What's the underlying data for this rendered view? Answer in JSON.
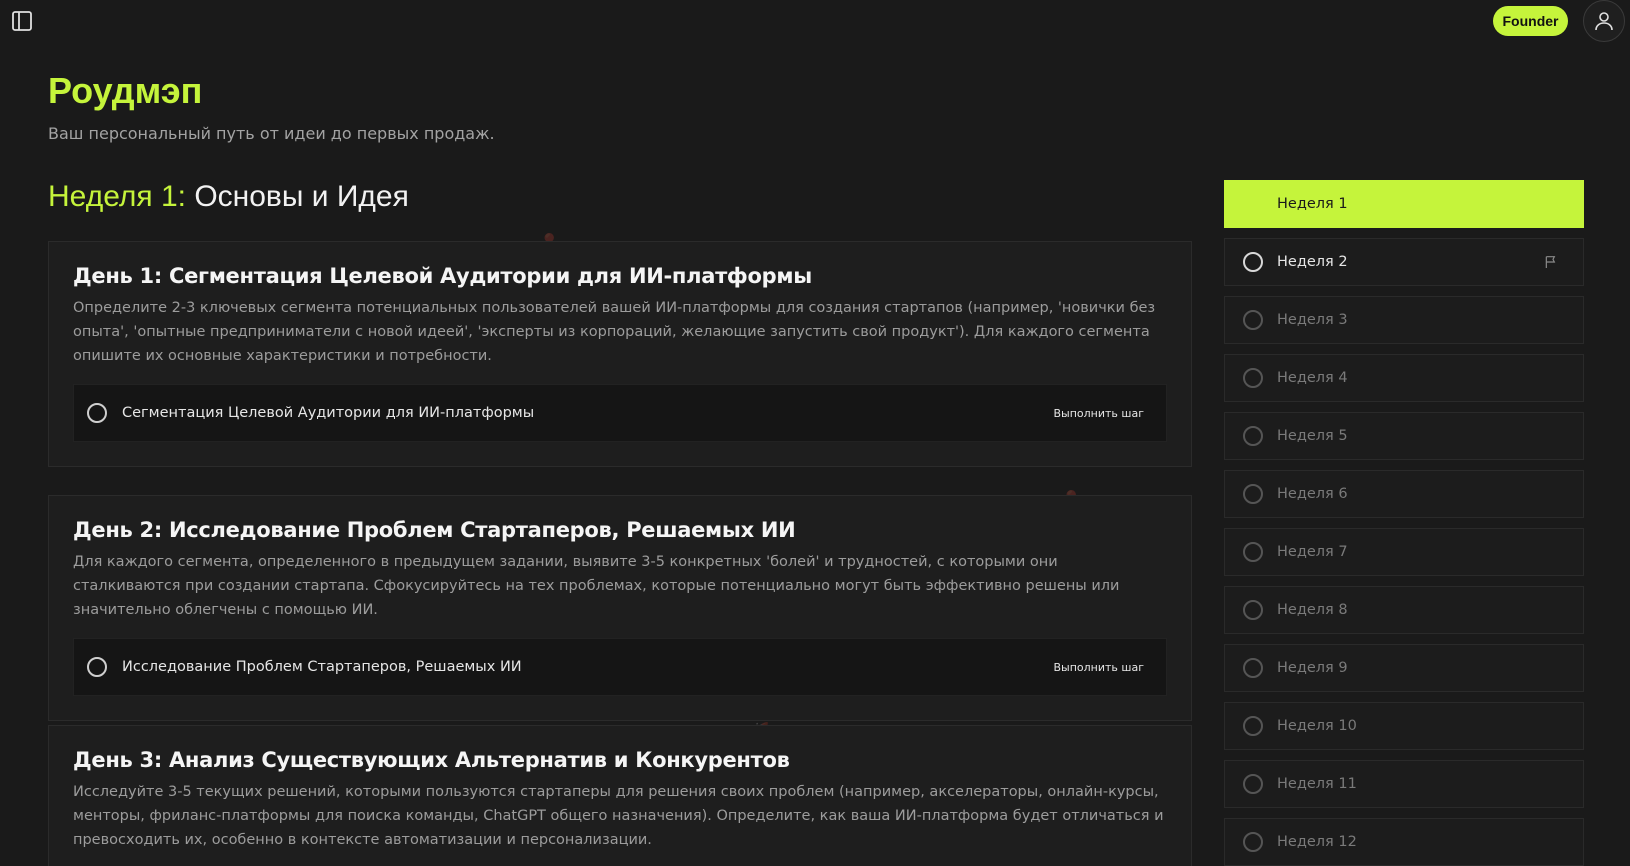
{
  "header": {
    "role_badge": "Founder",
    "title": "Роудмэп",
    "subtitle": "Ваш персональный путь от идеи до первых продаж."
  },
  "week": {
    "number_label": "Неделя 1:",
    "theme": "Основы и Идея"
  },
  "days": [
    {
      "title": "День 1: Сегментация Целевой Аудитории для ИИ-платформы",
      "description": "Определите 2-3 ключевых сегмента потенциальных пользователей вашей ИИ-платформы для создания стартапов (например, 'новички без опыта', 'опытные предприниматели с новой идеей', 'эксперты из корпораций, желающие запустить свой продукт'). Для каждого сегмента опишите их основные характеристики и потребности.",
      "step": {
        "label": "Сегментация Целевой Аудитории для ИИ-платформы",
        "action": "Выполнить шаг"
      }
    },
    {
      "title": "День 2: Исследование Проблем Стартаперов, Решаемых ИИ",
      "description": "Для каждого сегмента, определенного в предыдущем задании, выявите 3-5 конкретных 'болей' и трудностей, с которыми они сталкиваются при создании стартапа. Сфокусируйтесь на тех проблемах, которые потенциально могут быть эффективно решены или значительно облегчены с помощью ИИ.",
      "step": {
        "label": "Исследование Проблем Стартаперов, Решаемых ИИ",
        "action": "Выполнить шаг"
      }
    },
    {
      "title": "День 3: Анализ Существующих Альтернатив и Конкурентов",
      "description": "Исследуйте 3-5 текущих решений, которыми пользуются стартаперы для решения своих проблем (например, акселераторы, онлайн-курсы, менторы, фриланс-платформы для поиска команды, ChatGPT общего назначения). Определите, как ваша ИИ-платформа будет отличаться и превосходить их, особенно в контексте автоматизации и персонализации."
    }
  ],
  "weeks": [
    {
      "label": "Неделя 1",
      "state": "active"
    },
    {
      "label": "Неделя 2",
      "state": "current"
    },
    {
      "label": "Неделя 3",
      "state": "locked"
    },
    {
      "label": "Неделя 4",
      "state": "locked"
    },
    {
      "label": "Неделя 5",
      "state": "locked"
    },
    {
      "label": "Неделя 6",
      "state": "locked"
    },
    {
      "label": "Неделя 7",
      "state": "locked"
    },
    {
      "label": "Неделя 8",
      "state": "locked"
    },
    {
      "label": "Неделя 9",
      "state": "locked"
    },
    {
      "label": "Неделя 10",
      "state": "locked"
    },
    {
      "label": "Неделя 11",
      "state": "locked"
    },
    {
      "label": "Неделя 12",
      "state": "locked"
    }
  ],
  "colors": {
    "accent": "#c5f43b",
    "background": "#1a1a1a"
  },
  "icons": {
    "toggle": "sidebar-toggle-icon",
    "user": "user-icon",
    "flag": "flag-icon",
    "step": "circle-icon"
  }
}
